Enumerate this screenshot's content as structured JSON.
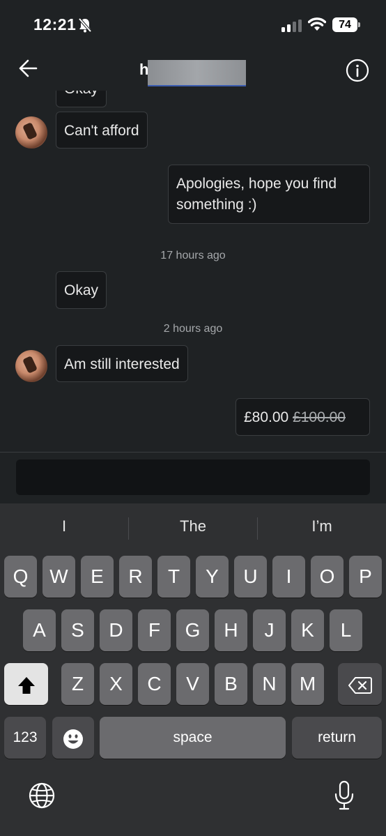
{
  "status": {
    "time": "12:21",
    "battery": "74"
  },
  "header": {
    "name_initial": "h"
  },
  "messages": {
    "m0": "Okay",
    "m1": "Can't afford",
    "m2": "Apologies, hope you find something :)",
    "ts1": "17 hours ago",
    "m3": "Okay",
    "ts2": "2 hours ago",
    "m4": "Am still interested",
    "offer_price": "£80.00",
    "offer_original": "£100.00"
  },
  "keyboard": {
    "suggestions": [
      "I",
      "The",
      "I’m"
    ],
    "row1": [
      "Q",
      "W",
      "E",
      "R",
      "T",
      "Y",
      "U",
      "I",
      "O",
      "P"
    ],
    "row2": [
      "A",
      "S",
      "D",
      "F",
      "G",
      "H",
      "J",
      "K",
      "L"
    ],
    "row3": [
      "Z",
      "X",
      "C",
      "V",
      "B",
      "N",
      "M"
    ],
    "numbers_label": "123",
    "space_label": "space",
    "return_label": "return"
  },
  "icons": [
    "bell-slash-icon",
    "signal-icon",
    "wifi-icon",
    "back-arrow-icon",
    "info-icon",
    "shift-icon",
    "backspace-icon",
    "emoji-icon",
    "globe-icon",
    "microphone-icon"
  ]
}
